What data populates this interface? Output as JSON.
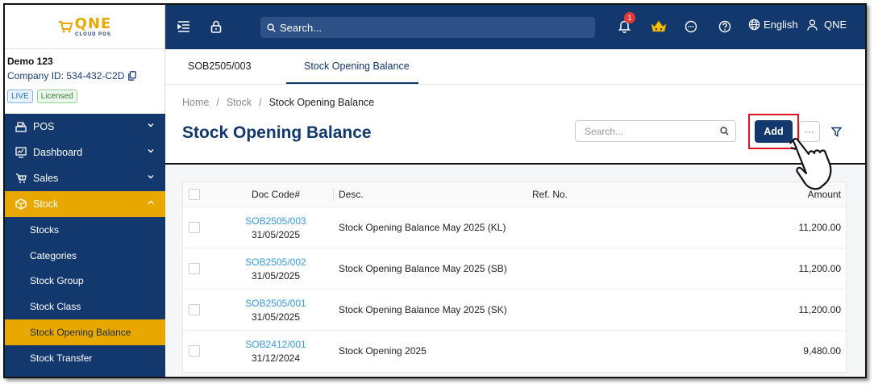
{
  "app": {
    "logo_text": "QNE",
    "logo_sub": "CLOUD POS"
  },
  "topbar": {
    "search_placeholder": "Search...",
    "notification_count": "1",
    "language": "English",
    "user": "QNE"
  },
  "company": {
    "name": "Demo 123",
    "id_label": "Company ID: 534-432-C2D",
    "badge_live": "LIVE",
    "badge_licensed": "Licensed"
  },
  "sidebar": {
    "items": [
      {
        "label": "POS",
        "icon": "pos-icon"
      },
      {
        "label": "Dashboard",
        "icon": "dashboard-icon"
      },
      {
        "label": "Sales",
        "icon": "cart-icon"
      },
      {
        "label": "Stock",
        "icon": "box-icon"
      }
    ],
    "stock_sub": [
      {
        "label": "Stocks"
      },
      {
        "label": "Categories"
      },
      {
        "label": "Stock Group"
      },
      {
        "label": "Stock Class"
      },
      {
        "label": "Stock Opening Balance"
      },
      {
        "label": "Stock Transfer"
      }
    ]
  },
  "tabs": [
    {
      "label": "SOB2505/003"
    },
    {
      "label": "Stock Opening Balance"
    }
  ],
  "breadcrumb": [
    "Home",
    "/",
    "Stock",
    "/",
    "Stock Opening Balance"
  ],
  "page": {
    "title": "Stock Opening Balance",
    "search_placeholder": "Search...",
    "add_label": "Add",
    "more_label": "···"
  },
  "table": {
    "headers": {
      "code": "Doc Code#",
      "desc": "Desc.",
      "ref": "Ref. No.",
      "amount": "Amount"
    },
    "rows": [
      {
        "code": "SOB2505/003",
        "date": "31/05/2025",
        "desc": "Stock Opening Balance May 2025 (KL)",
        "ref": "",
        "amount": "11,200.00"
      },
      {
        "code": "SOB2505/002",
        "date": "31/05/2025",
        "desc": "Stock Opening Balance May 2025 (SB)",
        "ref": "",
        "amount": "11,200.00"
      },
      {
        "code": "SOB2505/001",
        "date": "31/05/2025",
        "desc": "Stock Opening Balance May 2025 (SK)",
        "ref": "",
        "amount": "11,200.00"
      },
      {
        "code": "SOB2412/001",
        "date": "31/12/2024",
        "desc": "Stock Opening 2025",
        "ref": "",
        "amount": "9,480.00"
      }
    ]
  },
  "colors": {
    "primary": "#12386d",
    "accent": "#e8a800",
    "link": "#3a9ad9",
    "highlight": "#e0141e"
  }
}
